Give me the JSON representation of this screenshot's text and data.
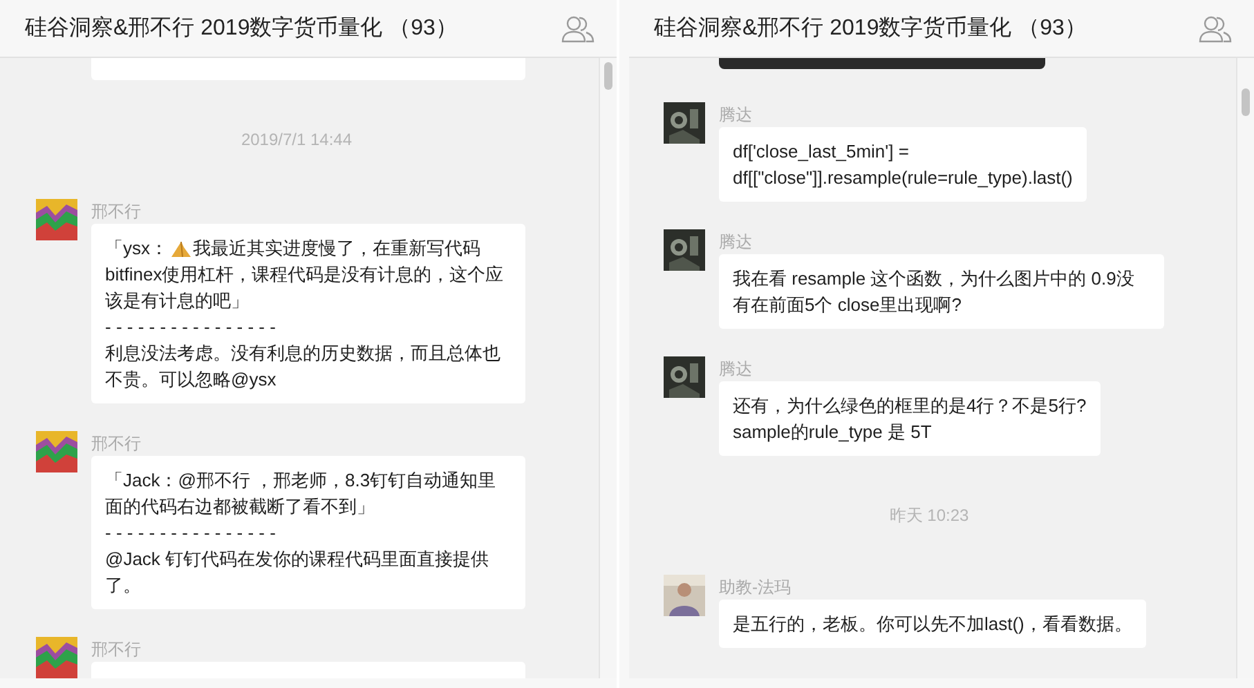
{
  "panels": [
    {
      "title": "硅谷洞察&邢不行 2019数字货币量化 （93）",
      "top": {
        "kind": "cut_bubble"
      },
      "items": [
        {
          "kind": "time",
          "text": "2019/7/1 14:44"
        },
        {
          "kind": "message",
          "sender": "邢不行",
          "avatar": {
            "kind": "stripes"
          },
          "paragraphs": [
            {
              "kind": "icon_line",
              "before": "「ysx：",
              "after": "我最近其实进度慢了，在重新写代码"
            },
            {
              "kind": "text",
              "text": "bitfinex使用杠杆，课程代码是没有计息的，这个应该是有计息的吧」"
            },
            {
              "kind": "text",
              "text": "- - - - - - - - - - - - - - - -"
            },
            {
              "kind": "text",
              "text": "利息没法考虑。没有利息的历史数据，而且总体也不贵。可以忽略@ysx"
            }
          ]
        },
        {
          "kind": "message",
          "sender": "邢不行",
          "avatar": {
            "kind": "stripes"
          },
          "paragraphs": [
            {
              "kind": "text",
              "text": "「Jack：@邢不行 ，邢老师，8.3钉钉自动通知里面的代码右边都被截断了看不到」"
            },
            {
              "kind": "text",
              "text": "- - - - - - - - - - - - - - - -"
            },
            {
              "kind": "text",
              "text": "@Jack 钉钉代码在发你的课程代码里面直接提供了。"
            }
          ]
        },
        {
          "kind": "message",
          "sender": "邢不行",
          "avatar": {
            "kind": "stripes"
          }
        }
      ]
    },
    {
      "title": "硅谷洞察&邢不行 2019数字货币量化 （93）",
      "top": {
        "kind": "cut_image"
      },
      "items": [
        {
          "kind": "message",
          "sender": "腾达",
          "avatar": {
            "kind": "dark_photo"
          },
          "paragraphs": [
            {
              "kind": "text",
              "text": "df['close_last_5min'] ="
            },
            {
              "kind": "text",
              "text": "df[[\"close\"]].resample(rule=rule_type).last()"
            }
          ]
        },
        {
          "kind": "message",
          "sender": "腾达",
          "avatar": {
            "kind": "dark_photo"
          },
          "paragraphs": [
            {
              "kind": "text",
              "text": "我在看 resample 这个函数，为什么图片中的 0.9没有在前面5个 close里出现啊?"
            }
          ]
        },
        {
          "kind": "message",
          "sender": "腾达",
          "avatar": {
            "kind": "dark_photo"
          },
          "paragraphs": [
            {
              "kind": "text",
              "text": "还有，为什么绿色的框里的是4行？不是5行?"
            },
            {
              "kind": "text",
              "text": "sample的rule_type 是 5T"
            }
          ]
        },
        {
          "kind": "time",
          "text": "昨天 10:23"
        },
        {
          "kind": "message",
          "sender": "助教-法玛",
          "avatar": {
            "kind": "person_photo"
          },
          "paragraphs": [
            {
              "kind": "text",
              "text": "是五行的，老板。你可以先不加last()，看看数据。"
            }
          ]
        }
      ]
    }
  ]
}
